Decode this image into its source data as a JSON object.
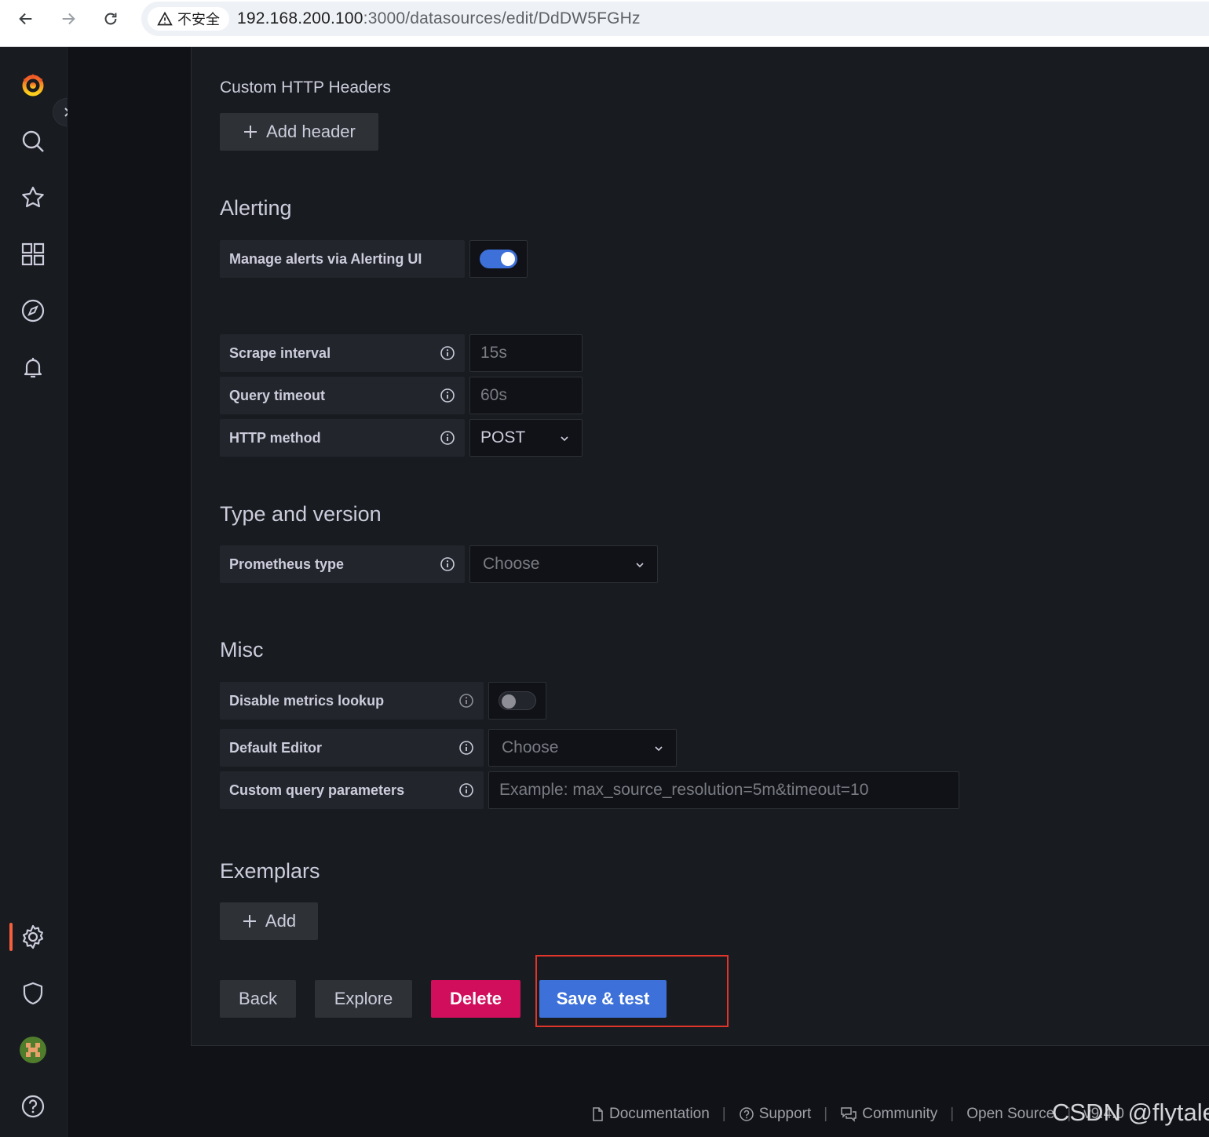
{
  "browser": {
    "security_label": "不安全",
    "url_host": "192.168.200.100",
    "url_rest": ":3000/datasources/edit/DdDW5FGHz"
  },
  "sidebar": {
    "items": [
      "grafana-logo-icon",
      "search-icon",
      "star-icon",
      "dashboards-icon",
      "explore-compass-icon",
      "alerting-bell-icon",
      "configuration-gear-icon",
      "server-admin-shield-icon",
      "user-avatar",
      "help-icon"
    ],
    "active_color": "#f55f3e"
  },
  "custom_headers": {
    "title": "Custom HTTP Headers",
    "add_label": "Add header"
  },
  "alerting": {
    "title": "Alerting",
    "manage_label": "Manage alerts via Alerting UI",
    "manage_enabled": true
  },
  "settings": {
    "scrape_label": "Scrape interval",
    "scrape_placeholder": "15s",
    "timeout_label": "Query timeout",
    "timeout_placeholder": "60s",
    "method_label": "HTTP method",
    "method_value": "POST"
  },
  "type_version": {
    "title": "Type and version",
    "prom_type_label": "Prometheus type",
    "prom_type_placeholder": "Choose"
  },
  "misc": {
    "title": "Misc",
    "disable_lookup_label": "Disable metrics lookup",
    "disable_lookup_enabled": false,
    "default_editor_label": "Default Editor",
    "default_editor_placeholder": "Choose",
    "custom_params_label": "Custom query parameters",
    "custom_params_placeholder": "Example: max_source_resolution=5m&timeout=10"
  },
  "exemplars": {
    "title": "Exemplars",
    "add_label": "Add"
  },
  "actions": {
    "back": "Back",
    "explore": "Explore",
    "delete": "Delete",
    "save": "Save & test"
  },
  "colors": {
    "primary": "#3d71d9",
    "destructive": "#d10e5c",
    "highlight": "#e0352b"
  },
  "footer": {
    "documentation": "Documentation",
    "support": "Support",
    "community": "Community",
    "open_source": "Open Source",
    "version": "v9.4.0"
  },
  "watermark": "CSDN @flytalei"
}
